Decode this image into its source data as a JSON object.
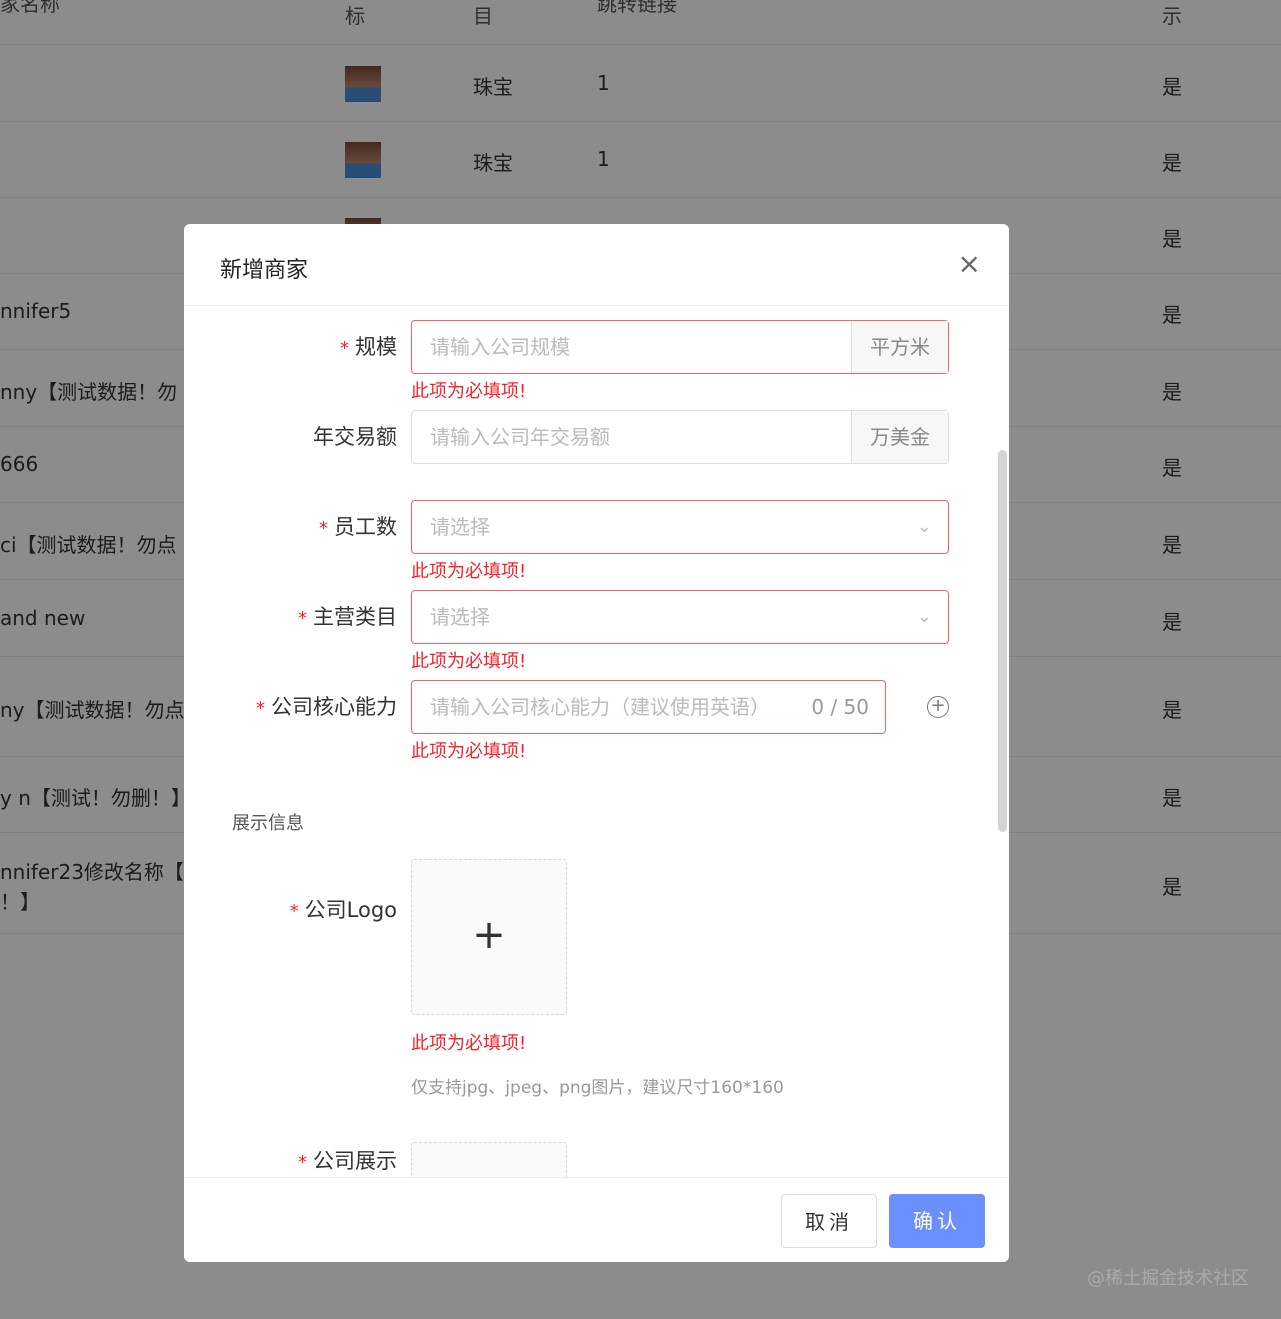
{
  "table": {
    "headers": [
      "家名称",
      "标",
      "目",
      "跳转链接",
      "示"
    ],
    "rows": [
      {
        "name": "",
        "category": "珠宝",
        "link": "1",
        "show": "是",
        "thumb": true
      },
      {
        "name": "",
        "category": "珠宝",
        "link": "1",
        "show": "是",
        "thumb": true
      },
      {
        "name": "",
        "category": "",
        "link": "",
        "show": "是",
        "thumb": true
      },
      {
        "name": "nnifer5",
        "category": "",
        "link": "",
        "show": "是"
      },
      {
        "name": "nny【测试数据！勿",
        "category": "",
        "link": "",
        "show": "是"
      },
      {
        "name": "666",
        "category": "",
        "link": "",
        "show": "是"
      },
      {
        "name": "ci【测试数据！勿点",
        "category": "",
        "link": "",
        "show": "是"
      },
      {
        "name": "and new",
        "category": "",
        "link": "",
        "show": "是"
      },
      {
        "name": "ny【测试数据！勿点",
        "category": "",
        "link": "",
        "show": "是"
      },
      {
        "name": "y n【测试！勿删！】",
        "category": "",
        "link": "",
        "show": "是"
      },
      {
        "name": "nnifer23修改名称【",
        "name2": "！】",
        "category": "",
        "link": "",
        "show": "是"
      }
    ]
  },
  "modal": {
    "title": "新增商家",
    "close": "×",
    "required_mark": "*",
    "fields": {
      "scale": {
        "label": "规模",
        "placeholder": "请输入公司规模",
        "addon": "平方米",
        "error": "此项为必填项!"
      },
      "turnover": {
        "label": "年交易额",
        "placeholder": "请输入公司年交易额",
        "addon": "万美金"
      },
      "employees": {
        "label": "员工数",
        "placeholder": "请选择",
        "error": "此项为必填项!"
      },
      "category": {
        "label": "主营类目",
        "placeholder": "请选择",
        "error": "此项为必填项!"
      },
      "core": {
        "label": "公司核心能力",
        "placeholder": "请输入公司核心能力（建议使用英语）",
        "count": "0 / 50",
        "error": "此项为必填项!"
      },
      "logo": {
        "label": "公司Logo",
        "error": "此项为必填项!",
        "hint": "仅支持jpg、jpeg、png图片，建议尺寸160*160"
      },
      "display": {
        "label": "公司展示"
      }
    },
    "section": "展示信息",
    "cancel": "取消",
    "confirm": "确认"
  },
  "watermark": "@稀土掘金技术社区",
  "colors": {
    "primary": "#6b8ffc",
    "error": "#f5222d"
  }
}
